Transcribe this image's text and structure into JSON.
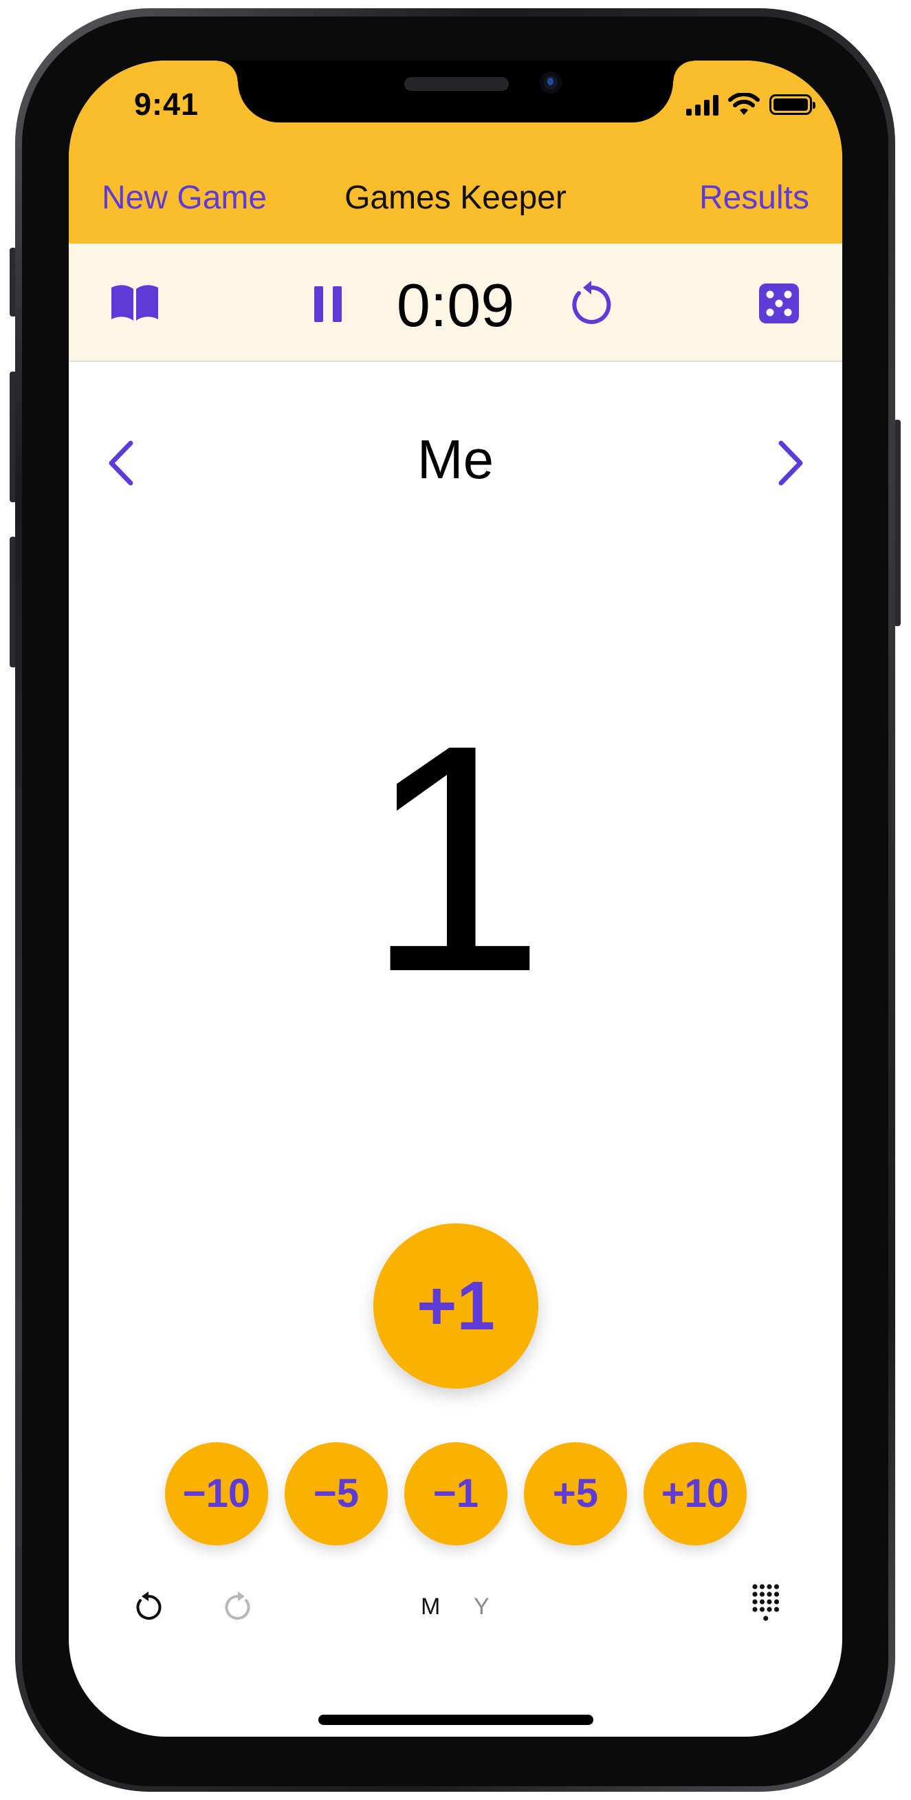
{
  "status_bar": {
    "time": "9:41"
  },
  "nav": {
    "left_label": "New Game",
    "title": "Games Keeper",
    "right_label": "Results"
  },
  "toolbar": {
    "timer": "0:09",
    "icons": [
      "book-icon",
      "pause-icon",
      "restart-icon",
      "dice-icon"
    ]
  },
  "player": {
    "name": "Me"
  },
  "score": "1",
  "primary_button": "+1",
  "step_buttons": [
    "−10",
    "−5",
    "−1",
    "+5",
    "+10"
  ],
  "bottom_bar": {
    "modes": [
      "M",
      "Y"
    ],
    "icons": [
      "undo-icon",
      "redo-icon",
      "keypad-icon"
    ]
  },
  "colors": {
    "header": "#fbbd2b",
    "toolbar": "#fdf6e6",
    "accent": "#5e3bd6",
    "button": "#fbb100"
  }
}
